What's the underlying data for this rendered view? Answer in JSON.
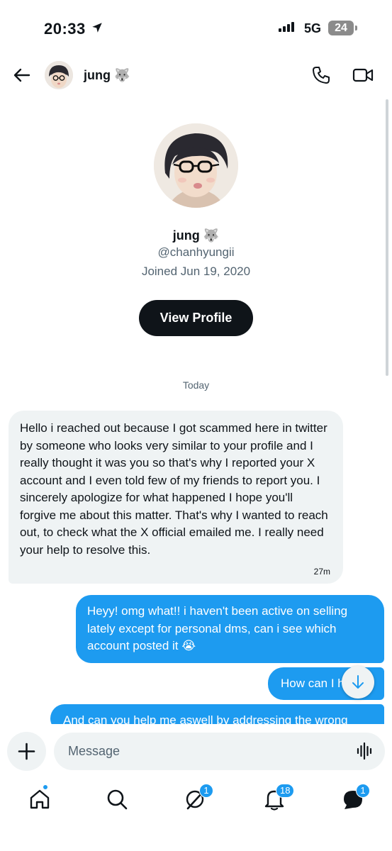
{
  "status_bar": {
    "time": "20:33",
    "network": "5G",
    "battery": "24",
    "icons": [
      "location-arrow-icon",
      "signal-bars-icon",
      "battery-icon"
    ]
  },
  "header": {
    "name": "jung 🐺",
    "icons": [
      "back-arrow-icon",
      "phone-icon",
      "video-camera-icon"
    ]
  },
  "profile": {
    "name": "jung 🐺",
    "handle": "@chanhyungii",
    "joined": "Joined Jun 19, 2020",
    "view_profile_label": "View Profile"
  },
  "conversation": {
    "date_separator": "Today",
    "messages": [
      {
        "direction": "incoming",
        "text": "Hello i reached out because I got scammed here in twitter by someone who looks very similar to your profile and I really thought it was you so that's why I reported your X account and I even told few of my friends to report you. I sincerely apologize for what happened I hope you'll forgive me about this matter. That's why I wanted to reach out, to check what the X official emailed me. I really need your help to resolve this.",
        "time": "27m"
      },
      {
        "direction": "outgoing",
        "text": "Heyy! omg what!! i haven't been active on selling lately except for personal dms, can i see which account posted it 😭"
      },
      {
        "direction": "outgoing",
        "text": "How can I h"
      },
      {
        "direction": "outgoing",
        "text": "And can you help me aswell by addressing the wrong"
      }
    ]
  },
  "composer": {
    "placeholder": "Message"
  },
  "tabbar": {
    "badges": {
      "grok": "1",
      "notifications": "18",
      "messages": "1"
    }
  },
  "colors": {
    "accent": "#1d9bf0",
    "incoming_bubble": "#eff3f4",
    "primary_button": "#0f1419"
  }
}
